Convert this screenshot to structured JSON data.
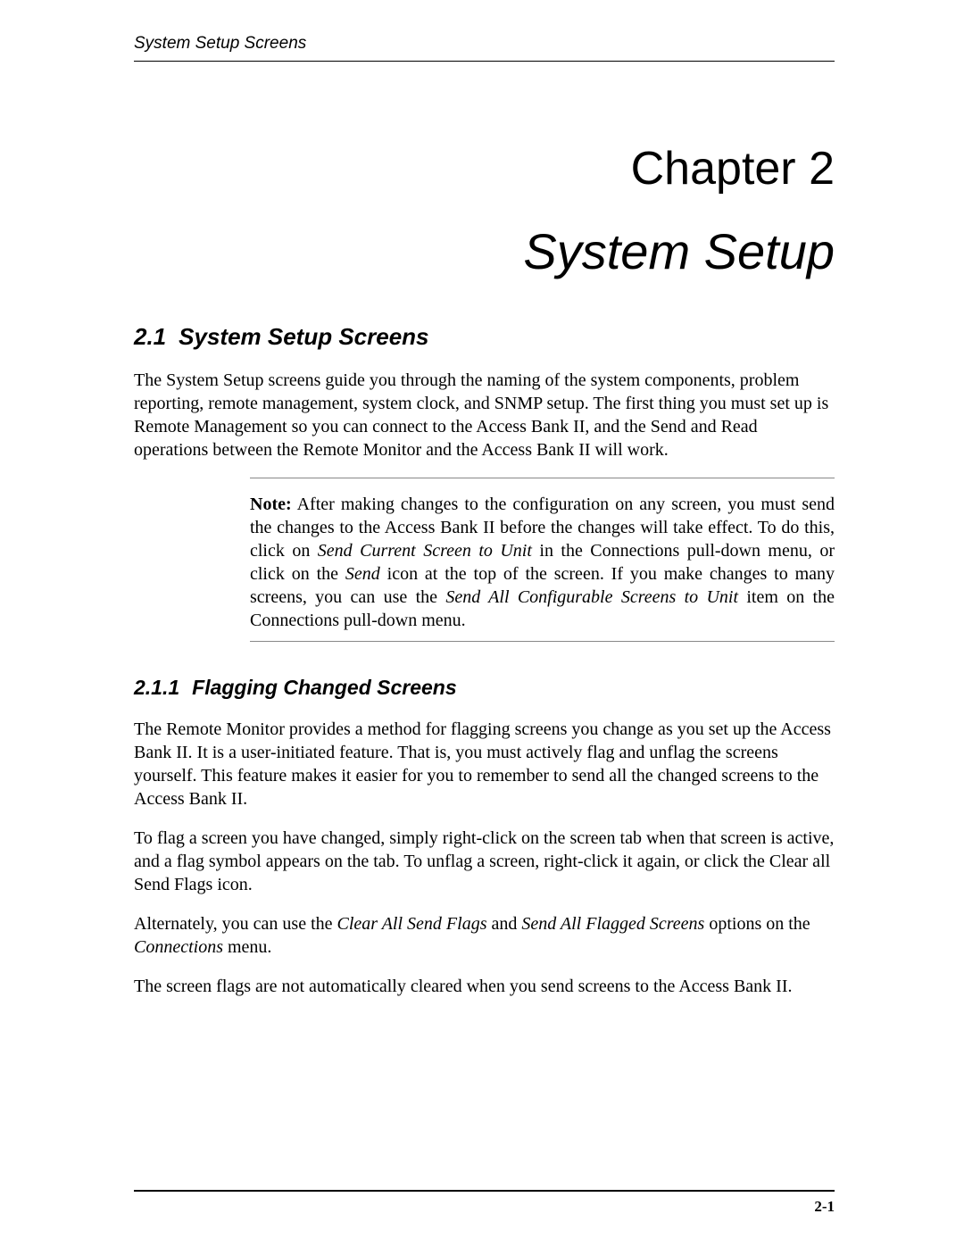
{
  "header": {
    "running": "System Setup Screens"
  },
  "chapter": {
    "number_label": "Chapter 2",
    "title": "System Setup"
  },
  "section_2_1": {
    "number": "2.1",
    "title": "System Setup Screens",
    "para1": "The System Setup screens guide you through the naming of the system components, problem reporting, remote management, system clock, and SNMP setup. The first thing you must set up is Remote Management so you can connect to the Access Bank II, and the Send and Read operations between the Remote Monitor and the Access Bank II will work."
  },
  "note": {
    "label": "Note:",
    "part1": "  After making changes to the configuration on any screen, you must send the changes to the Access Bank II before the changes will take effect. To do this, click on ",
    "italic1": "Send Current Screen to Unit",
    "part2": " in the Connections pull-down menu, or click on the ",
    "italic2": "Send",
    "part3": " icon at the top of the screen. If you make changes to many screens, you can use the ",
    "italic3": "Send All Configurable Screens to Unit",
    "part4": " item on the Connections pull-down menu."
  },
  "section_2_1_1": {
    "number": "2.1.1",
    "title": "Flagging Changed Screens",
    "para1": "The Remote Monitor provides a method for flagging screens you change as you set up the Access Bank II. It is a user-initiated feature. That is, you must actively flag and unflag the screens yourself. This feature makes it easier for you to remember to send all the changed screens to the Access Bank II.",
    "para2": "To flag a screen you have changed, simply right-click on the screen tab when that screen is active, and a flag symbol appears on the tab. To unflag a screen, right-click it again, or click the Clear all Send Flags icon.",
    "para3_a": "Alternately, you can use the ",
    "para3_i1": "Clear All Send Flags",
    "para3_b": " and ",
    "para3_i2": "Send All Flagged Screens",
    "para3_c": " options on the ",
    "para3_i3": "Connections",
    "para3_d": " menu.",
    "para4": "The screen flags are not automatically cleared when you send screens to the Access Bank II."
  },
  "footer": {
    "page": "2-1"
  }
}
